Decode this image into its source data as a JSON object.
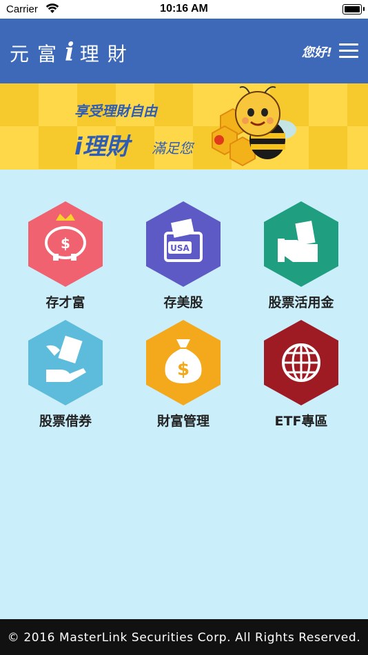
{
  "status_bar": {
    "carrier": "Carrier",
    "time": "10:16 AM"
  },
  "header": {
    "logo_chars": [
      "元",
      "富",
      "i",
      "理",
      "財"
    ],
    "greeting": "您好!",
    "brand_color": "#3e69b8"
  },
  "banner": {
    "line1": "享受理財自由",
    "line2": "i理財",
    "line3": "滿足您",
    "background": "#ffd84a"
  },
  "menu": [
    {
      "label": "存才富",
      "icon": "piggy-bank-icon",
      "color": "#f0626f"
    },
    {
      "label": "存美股",
      "icon": "usa-wallet-icon",
      "color": "#5d5ac6"
    },
    {
      "label": "股票活用金",
      "icon": "cash-hand-icon",
      "color": "#1f9e80"
    },
    {
      "label": "股票借券",
      "icon": "stock-lending-icon",
      "color": "#5dbcdb"
    },
    {
      "label": "財富管理",
      "icon": "money-bag-icon",
      "color": "#f4a81c"
    },
    {
      "label": "ETF專區",
      "icon": "globe-icon",
      "color": "#9e1b24"
    }
  ],
  "footer": {
    "copyright": "© 2016 MasterLink Securities Corp. All Rights Reserved."
  }
}
